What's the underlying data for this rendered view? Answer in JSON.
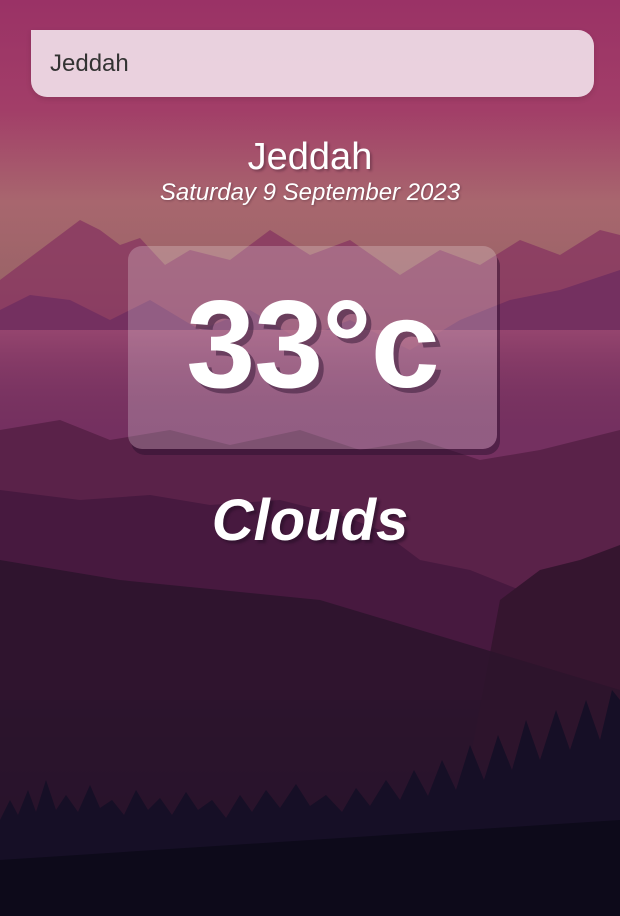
{
  "search": {
    "value": "Jeddah"
  },
  "location": {
    "city": "Jeddah",
    "date": "Saturday 9 September 2023"
  },
  "weather": {
    "temperature": "33°c",
    "condition": "Clouds"
  },
  "colors": {
    "sky_top": "#9d3567",
    "horizon": "#a86870",
    "mountain_far": "#7a2e5c",
    "mountain_mid": "#5c2349",
    "valley": "#3d1a3a",
    "forest": "#120d22",
    "text": "#ffffff"
  }
}
